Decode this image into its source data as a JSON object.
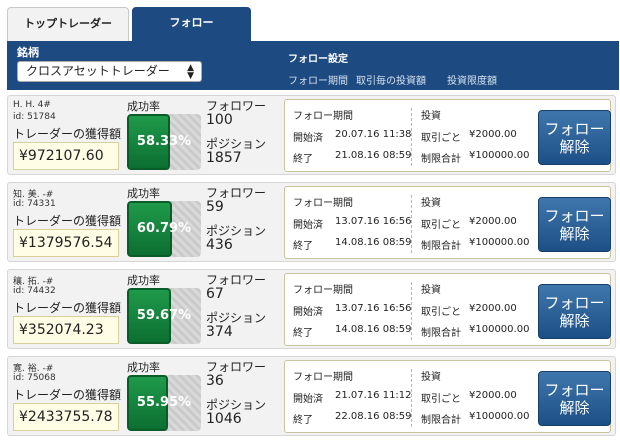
{
  "tabs": [
    {
      "label": "トップトレーダー"
    },
    {
      "label": "フォロー"
    }
  ],
  "header": {
    "issue_label": "銘柄",
    "select_value": "クロスアセットトレーダー",
    "follow_settings": "フォロー設定",
    "col_period": "フォロー期間",
    "col_per_trade": "取引毎の投資額",
    "col_limit": "投資限度額"
  },
  "labels": {
    "earnings": "トレーダーの獲得額",
    "success_rate": "成功率",
    "followers": "フォロワー",
    "position": "ポジション",
    "follow_period": "フォロー期間",
    "start": "開始済",
    "end": "終了",
    "investment": "投資",
    "per_trade": "取引ごと",
    "limit_total": "制限合計",
    "unfollow_line1": "フォロー",
    "unfollow_line2": "解除"
  },
  "traders": [
    {
      "name": "H. H.  4#",
      "id": "id: 51784",
      "earnings": "¥972107.60",
      "success_rate": "58.33%",
      "success_value": 58.33,
      "followers": "100",
      "positions": "1857",
      "start": "20.07.16 11:38",
      "end": "21.08.16 08:59",
      "per_trade": "¥2000.00",
      "limit": "¥100000.00"
    },
    {
      "name": "知. 美.  -#",
      "id": "id: 74331",
      "earnings": "¥1379576.54",
      "success_rate": "60.79%",
      "success_value": 60.79,
      "followers": "59",
      "positions": "436",
      "start": "13.07.16 16:56",
      "end": "14.08.16 08:59",
      "per_trade": "¥2000.00",
      "limit": "¥100000.00"
    },
    {
      "name": "穰. 拓.  -#",
      "id": "id: 74432",
      "earnings": "¥352074.23",
      "success_rate": "59.67%",
      "success_value": 59.67,
      "followers": "67",
      "positions": "374",
      "start": "13.07.16 16:56",
      "end": "14.08.16 08:59",
      "per_trade": "¥2000.00",
      "limit": "¥100000.00"
    },
    {
      "name": "寛. 裕.  -#",
      "id": "id: 75068",
      "earnings": "¥2433755.78",
      "success_rate": "55.95%",
      "success_value": 55.95,
      "followers": "36",
      "positions": "1046",
      "start": "21.07.16 11:12",
      "end": "22.08.16 08:59",
      "per_trade": "¥2000.00",
      "limit": "¥100000.00"
    }
  ],
  "colors": {
    "header": "#1d4a80",
    "success_bar": "#1f9a4a",
    "unfollow_button": "#2a6399"
  }
}
